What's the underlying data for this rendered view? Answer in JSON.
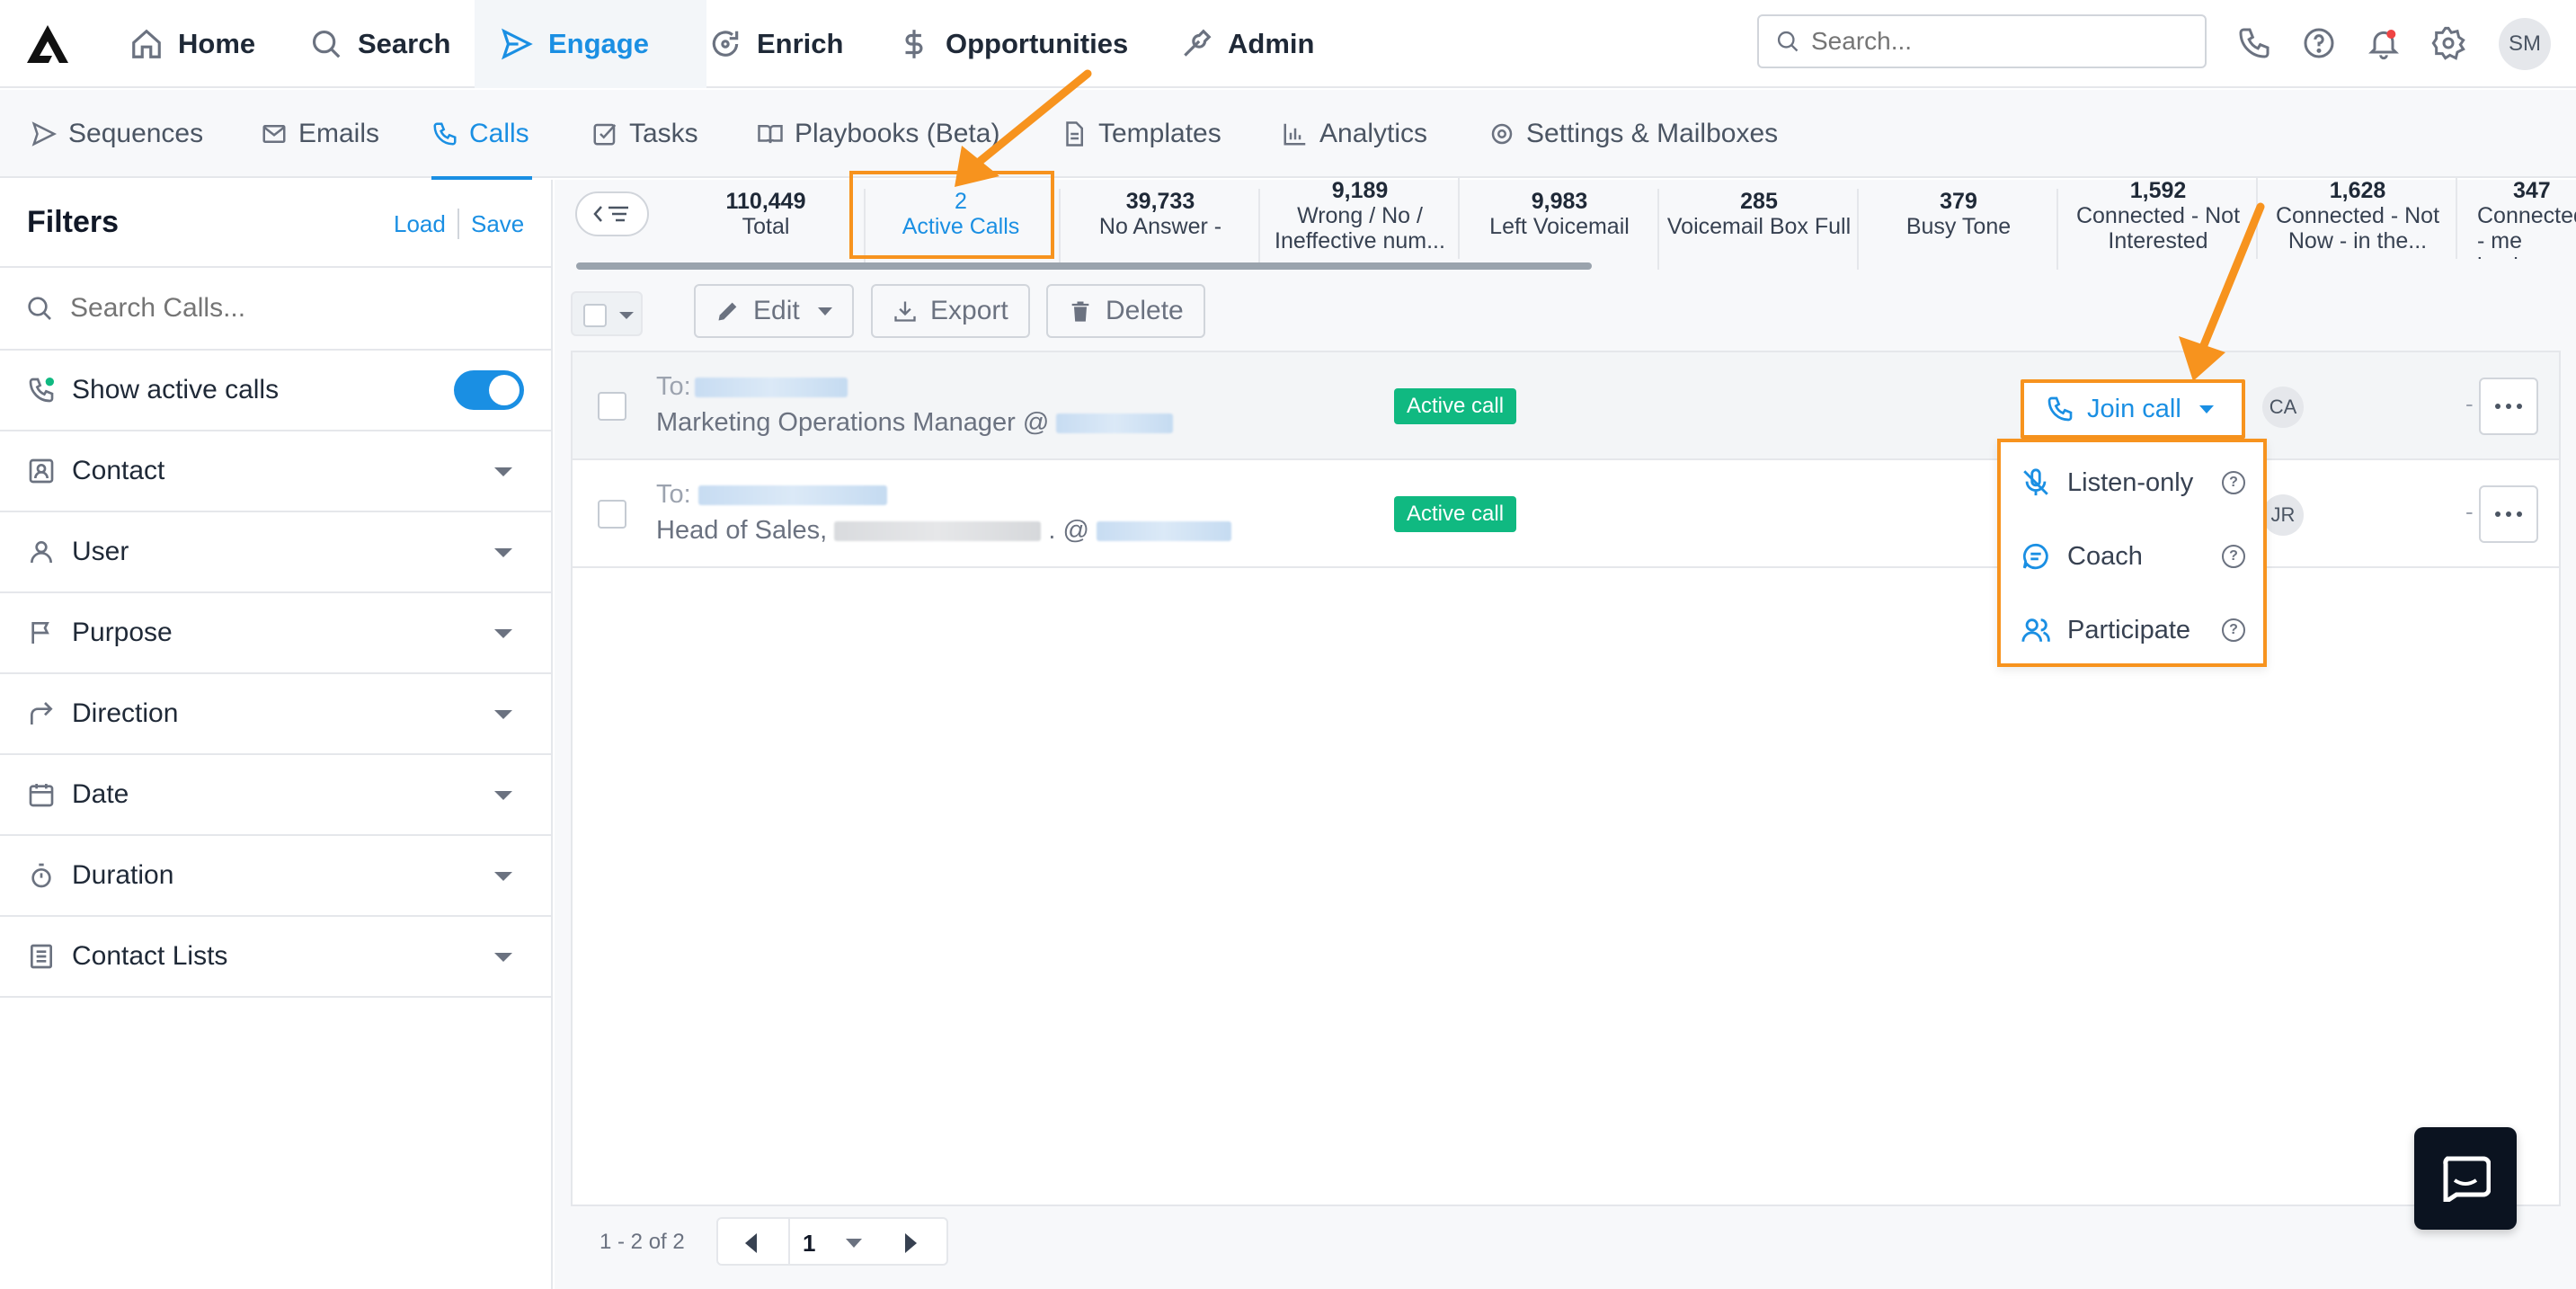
{
  "topnav": {
    "items": [
      {
        "label": "Home",
        "icon": "home-icon"
      },
      {
        "label": "Search",
        "icon": "search-icon"
      },
      {
        "label": "Engage",
        "icon": "send-icon",
        "active": true
      },
      {
        "label": "Enrich",
        "icon": "refresh-icon"
      },
      {
        "label": "Opportunities",
        "icon": "dollar-icon"
      },
      {
        "label": "Admin",
        "icon": "wrench-icon"
      }
    ],
    "search_placeholder": "Search...",
    "avatar": "SM"
  },
  "subnav": {
    "items": [
      {
        "label": "Sequences",
        "icon": "send-icon"
      },
      {
        "label": "Emails",
        "icon": "mail-icon"
      },
      {
        "label": "Calls",
        "icon": "phone-icon",
        "active": true
      },
      {
        "label": "Tasks",
        "icon": "checkbox-icon"
      },
      {
        "label": "Playbooks (Beta)",
        "icon": "book-icon"
      },
      {
        "label": "Templates",
        "icon": "document-icon"
      },
      {
        "label": "Analytics",
        "icon": "bar-chart-icon"
      },
      {
        "label": "Settings & Mailboxes",
        "icon": "gear-icon"
      }
    ]
  },
  "sidebar": {
    "title": "Filters",
    "load": "Load",
    "save": "Save",
    "search_placeholder": "Search Calls...",
    "show_active": "Show active calls",
    "show_active_on": true,
    "filters": [
      {
        "label": "Contact",
        "icon": "contact-card-icon"
      },
      {
        "label": "User",
        "icon": "user-icon"
      },
      {
        "label": "Purpose",
        "icon": "flag-icon"
      },
      {
        "label": "Direction",
        "icon": "arrow-turn-icon"
      },
      {
        "label": "Date",
        "icon": "calendar-icon"
      },
      {
        "label": "Duration",
        "icon": "stopwatch-icon"
      },
      {
        "label": "Contact Lists",
        "icon": "list-icon"
      }
    ]
  },
  "stats": [
    {
      "num": "110,449",
      "label": "Total"
    },
    {
      "num": "2",
      "label": "Active Calls"
    },
    {
      "num": "39,733",
      "label": "No Answer -"
    },
    {
      "num": "9,189",
      "label": "Wrong / No / Ineffective num..."
    },
    {
      "num": "9,983",
      "label": "Left Voicemail"
    },
    {
      "num": "285",
      "label": "Voicemail Box Full"
    },
    {
      "num": "379",
      "label": "Busy Tone"
    },
    {
      "num": "1,592",
      "label": "Connected - Not Interested"
    },
    {
      "num": "1,628",
      "label": "Connected - Not Now - in the..."
    },
    {
      "num": "347",
      "label": "Connected - me back"
    }
  ],
  "toolbar": {
    "edit": "Edit",
    "export": "Export",
    "delete": "Delete"
  },
  "rows": [
    {
      "to": "To:",
      "subtitle": "Marketing Operations Manager @",
      "badge": "Active call",
      "initials": "CA",
      "dash": "-"
    },
    {
      "to": "To:",
      "subtitle_a": "Head of Sales,",
      "subtitle_b": ". @",
      "badge": "Active call",
      "initials": "JR",
      "dash": "-"
    }
  ],
  "join_call": {
    "label": "Join call",
    "options": [
      {
        "label": "Listen-only",
        "icon": "mic-off-icon"
      },
      {
        "label": "Coach",
        "icon": "chat-bubble-icon"
      },
      {
        "label": "Participate",
        "icon": "users-icon"
      }
    ]
  },
  "pager": {
    "info": "1 - 2 of 2",
    "page": "1"
  },
  "colors": {
    "accent": "#1a8fe3",
    "annotation": "#f7931e",
    "active_badge": "#10b981"
  }
}
